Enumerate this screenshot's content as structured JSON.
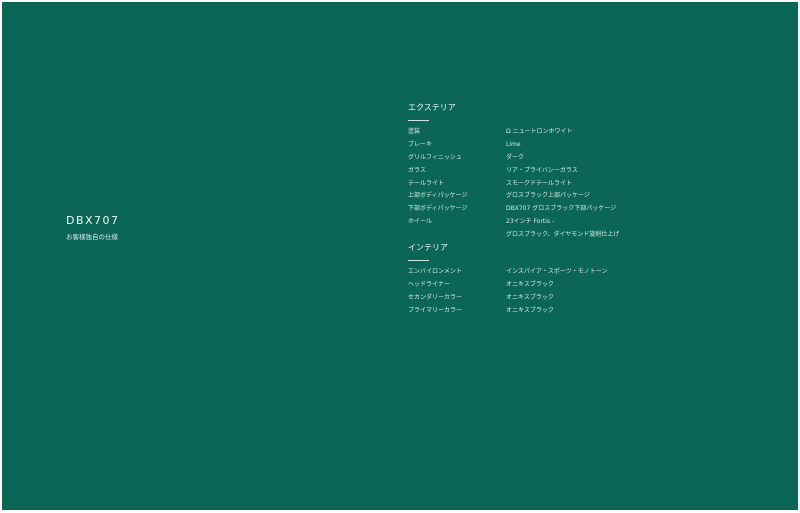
{
  "model": {
    "name": "DBX707",
    "subtitle": "お客様独自の仕様"
  },
  "exterior": {
    "title": "エクステリア",
    "rows": [
      {
        "label": "塗装",
        "value": "Ω ニュートロンホワイト"
      },
      {
        "label": "ブレーキ",
        "value": "Lime"
      },
      {
        "label": "グリルフィニッシュ",
        "value": "ダーク"
      },
      {
        "label": "ガラス",
        "value": "リア・プライバシーガラス"
      },
      {
        "label": "テールライト",
        "value": "スモークドテールライト"
      },
      {
        "label": "上部ボディパッケージ",
        "value": "グロスブラック上部パッケージ"
      },
      {
        "label": "下部ボディパッケージ",
        "value": "DBX707 グロスブラック下部パッケージ"
      },
      {
        "label": "ホイール",
        "value": "23インチ Fortis -"
      },
      {
        "label": "",
        "value": "グロスブラック、ダイヤモンド旋削仕上げ"
      }
    ]
  },
  "interior": {
    "title": "インテリア",
    "rows": [
      {
        "label": "エンバイロンメント",
        "value": "インスパイア・スポーツ・モノトーン"
      },
      {
        "label": "ヘッドライナー",
        "value": "オニキスブラック"
      },
      {
        "label": "セカンダリーカラー",
        "value": "オニキスブラック"
      },
      {
        "label": "プライマリーカラー",
        "value": "オニキスブラック"
      }
    ]
  },
  "colors": {
    "background": "#0b6658",
    "text": "#d7ebe6"
  }
}
